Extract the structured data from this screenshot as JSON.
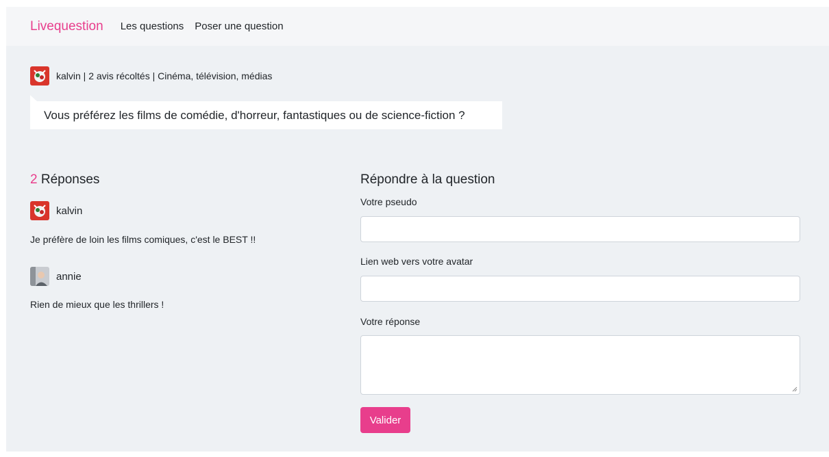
{
  "nav": {
    "brand": "Livequestion",
    "links": [
      "Les questions",
      "Poser une question"
    ]
  },
  "question": {
    "meta": "kalvin | 2 avis récoltés | Cinéma, télévision, médias",
    "text": "Vous préférez les films de comédie, d'horreur, fantastiques ou de science-fiction ?"
  },
  "answers": {
    "count": "2",
    "title": "Réponses",
    "items": [
      {
        "user": "kalvin",
        "text": "Je préfère de loin les films comiques, c'est le BEST !!",
        "avatar": "kalvin-avatar-icon"
      },
      {
        "user": "annie",
        "text": "Rien de mieux que les thrillers !",
        "avatar": "annie-avatar-photo"
      }
    ]
  },
  "form": {
    "title": "Répondre à la question",
    "pseudo_label": "Votre pseudo",
    "pseudo_value": "",
    "avatar_label": "Lien web vers votre avatar",
    "avatar_value": "",
    "answer_label": "Votre réponse",
    "answer_value": "",
    "submit_label": "Valider"
  },
  "colors": {
    "accent": "#e83e8c",
    "page_bg": "#eef1f4",
    "navbar_bg": "#f5f6f8"
  }
}
